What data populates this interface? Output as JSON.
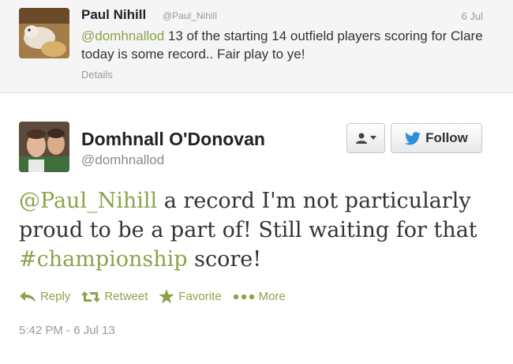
{
  "reply": {
    "name": "Paul Nihill",
    "handle": "@Paul_Nihill",
    "date": "6 Jul",
    "mention": "@domhnallod",
    "text_rest": " 13 of the starting 14 outfield players scoring for Clare today is some record.. Fair play to ye!",
    "details": "Details"
  },
  "tweet": {
    "name": "Domhnall O'Donovan",
    "handle": "@domhnallod",
    "mention": "@Paul_Nihill",
    "text_part1": " a record I'm not particularly proud to be a part of! Still waiting for that ",
    "hashtag": "#championship",
    "text_part2": " score!",
    "timestamp": "5:42 PM - 6 Jul 13"
  },
  "buttons": {
    "follow": "Follow"
  },
  "actions": {
    "reply": "Reply",
    "retweet": "Retweet",
    "favorite": "Favorite",
    "more": "More"
  },
  "colors": {
    "link": "#8aa34a",
    "twitter_blue": "#2b90d9"
  }
}
